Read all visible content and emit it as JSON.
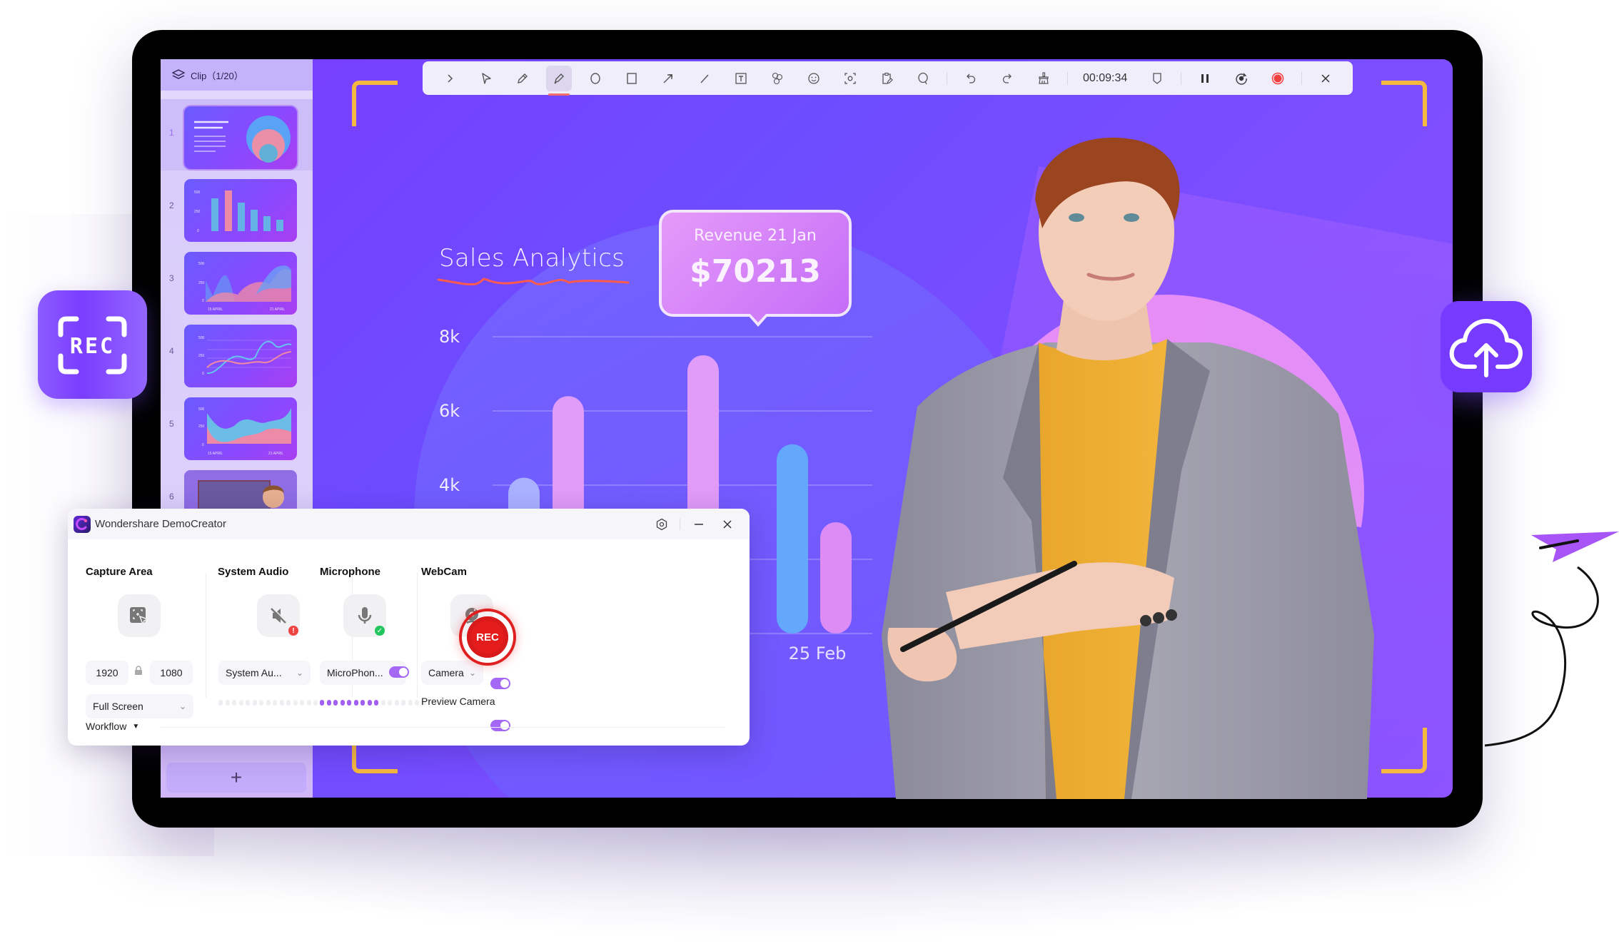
{
  "toolbar": {
    "tools": [
      {
        "name": "expand",
        "icon": "chevron-right-icon"
      },
      {
        "name": "select",
        "icon": "cursor-icon"
      },
      {
        "name": "pen",
        "icon": "pen-icon"
      },
      {
        "name": "highlighter",
        "icon": "highlighter-icon",
        "active": true
      },
      {
        "name": "circle",
        "icon": "circle-icon"
      },
      {
        "name": "rectangle",
        "icon": "rectangle-icon"
      },
      {
        "name": "arrow",
        "icon": "arrow-icon"
      },
      {
        "name": "line",
        "icon": "line-icon"
      },
      {
        "name": "text",
        "icon": "text-icon"
      },
      {
        "name": "number-stamp",
        "icon": "numbered-stamp-icon"
      },
      {
        "name": "emoji",
        "icon": "smiley-icon"
      },
      {
        "name": "spotlight",
        "icon": "spotlight-icon"
      },
      {
        "name": "clipboard-edit",
        "icon": "clipboard-edit-icon"
      },
      {
        "name": "magnifier",
        "icon": "magnifier-icon"
      },
      {
        "name": "undo",
        "icon": "undo-icon"
      },
      {
        "name": "redo",
        "icon": "redo-icon"
      },
      {
        "name": "clear",
        "icon": "broom-icon"
      }
    ],
    "timer": "00:09:34",
    "controls": [
      "marker-icon",
      "pause-icon",
      "restart-icon",
      "record-icon",
      "close-icon"
    ],
    "accent": "#f46b6b"
  },
  "sidebar": {
    "title": "Clip（1/20）",
    "slides": [
      {
        "num": "1",
        "kind": "circles",
        "active": true
      },
      {
        "num": "2",
        "kind": "bars"
      },
      {
        "num": "3",
        "kind": "area"
      },
      {
        "num": "4",
        "kind": "lines"
      },
      {
        "num": "5",
        "kind": "area2"
      },
      {
        "num": "6",
        "kind": "avatar"
      }
    ],
    "add_label": "+"
  },
  "slide": {
    "title": "Sales Analytics",
    "tooltip": {
      "label": "Revenue 21 Jan",
      "value": "$70213"
    },
    "brand_color": "#7a3cff",
    "bracket_color": "#f6b940"
  },
  "chart_data": {
    "type": "bar",
    "title": "Sales Analytics",
    "xlabel": "",
    "ylabel": "",
    "ylim": [
      0,
      8000
    ],
    "yticks": [
      "8k",
      "6k",
      "4k"
    ],
    "ytick_values": [
      8000,
      6000,
      4000,
      2000,
      0
    ],
    "visible_xlabels": [
      {
        "after_index": 4,
        "label": "25 Feb"
      }
    ],
    "bars": [
      {
        "value": 4200,
        "color": "#aab2ff",
        "group": 0
      },
      {
        "value": 6400,
        "color": "#e19bf8",
        "group": 0
      },
      {
        "value": 7500,
        "color": "#e19bf8",
        "group": 1
      },
      {
        "value": 5100,
        "color": "#63a8fb",
        "group": 2
      },
      {
        "value": 3000,
        "color": "#dc8cf4",
        "group": 2
      }
    ],
    "annotation": {
      "bar_index": 2,
      "label": "Revenue 21 Jan",
      "value": "$70213"
    },
    "grid": true
  },
  "recorder": {
    "app_title": "Wondershare DemoCreator",
    "columns": {
      "capture": {
        "label": "Capture Area",
        "width": "1920",
        "height": "1080",
        "mode": "Full Screen"
      },
      "system_audio": {
        "label": "System Audio",
        "device": "System Au...",
        "status": "muted-warning",
        "level_on": 0,
        "level_total": 17
      },
      "microphone": {
        "label": "Microphone",
        "device": "MicroPhon...",
        "enabled": true,
        "status": "ok",
        "level_on": 9,
        "level_total": 16
      },
      "webcam": {
        "label": "WebCam",
        "device": "Camera",
        "enabled": true,
        "preview_label": "Preview Camera",
        "preview_enabled": true
      }
    },
    "rec_label": "REC",
    "workflow_label": "Workflow",
    "accent": "#a468f5",
    "rec_color": "#e51c1c"
  },
  "badges": {
    "rec_label": "REC",
    "upload_icon": "cloud-upload-icon"
  }
}
